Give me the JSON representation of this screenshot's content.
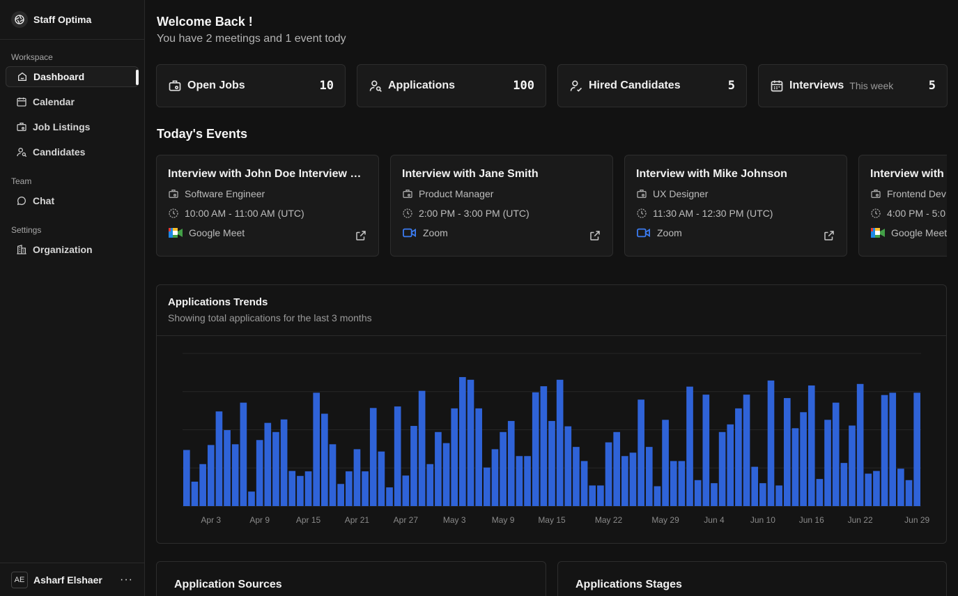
{
  "brand": {
    "name": "Staff Optima"
  },
  "sidebar": {
    "sections": [
      {
        "label": "Workspace",
        "items": [
          {
            "label": "Dashboard",
            "icon": "home-icon",
            "active": true
          },
          {
            "label": "Calendar",
            "icon": "calendar-icon"
          },
          {
            "label": "Job Listings",
            "icon": "briefcase-icon"
          },
          {
            "label": "Candidates",
            "icon": "user-search-icon"
          }
        ]
      },
      {
        "label": "Team",
        "items": [
          {
            "label": "Chat",
            "icon": "chat-icon"
          }
        ]
      },
      {
        "label": "Settings",
        "items": [
          {
            "label": "Organization",
            "icon": "building-icon"
          }
        ]
      }
    ],
    "user": {
      "initials": "AE",
      "name": "Asharf Elshaer",
      "menu": "···"
    }
  },
  "header": {
    "title": "Welcome Back !",
    "subtitle": "You have 2 meetings and 1 event tody"
  },
  "stats": [
    {
      "label": "Open Jobs",
      "value": "10",
      "icon": "briefcase-icon"
    },
    {
      "label": "Applications",
      "value": "100",
      "icon": "user-search-icon"
    },
    {
      "label": "Hired Candidates",
      "value": "5",
      "icon": "user-check-icon"
    },
    {
      "label": "Interviews",
      "sub": "This week",
      "value": "5",
      "icon": "calendar-icon"
    }
  ],
  "events": {
    "title": "Today's Events",
    "items": [
      {
        "title": "Interview with John Doe Interview …",
        "role": "Software Engineer",
        "time": "10:00 AM - 11:00 AM (UTC)",
        "platform": "Google Meet",
        "platform_icon": "google-meet-icon"
      },
      {
        "title": "Interview with Jane Smith",
        "role": "Product Manager",
        "time": "2:00 PM - 3:00 PM (UTC)",
        "platform": "Zoom",
        "platform_icon": "zoom-icon"
      },
      {
        "title": "Interview with Mike Johnson",
        "role": "UX Designer",
        "time": "11:30 AM - 12:30 PM (UTC)",
        "platform": "Zoom",
        "platform_icon": "zoom-icon"
      },
      {
        "title": "Interview with",
        "role": "Frontend Dev",
        "time": "4:00 PM - 5:0",
        "platform": "Google Meet",
        "platform_icon": "google-meet-icon"
      }
    ]
  },
  "chart_card": {
    "title": "Applications Trends",
    "subtitle": "Showing total applications for the last 3 months"
  },
  "chart_data": {
    "type": "bar",
    "title": "Applications Trends",
    "bar_color": "#2f63d8",
    "grid": true,
    "ylim": [
      0,
      400
    ],
    "x_tick_labels": [
      "Apr 3",
      "Apr 9",
      "Apr 15",
      "Apr 21",
      "Apr 27",
      "May 3",
      "May 9",
      "May 15",
      "May 22",
      "May 29",
      "Jun 4",
      "Jun 10",
      "Jun 16",
      "Jun 22",
      "Jun 29"
    ],
    "x_tick_positions": [
      3,
      9,
      15,
      21,
      27,
      33,
      39,
      45,
      52,
      59,
      65,
      71,
      77,
      83,
      90
    ],
    "values": [
      147,
      64,
      110,
      160,
      248,
      199,
      162,
      271,
      38,
      173,
      218,
      194,
      227,
      92,
      79,
      91,
      297,
      242,
      162,
      58,
      91,
      149,
      91,
      257,
      143,
      49,
      261,
      80,
      210,
      302,
      110,
      194,
      165,
      256,
      338,
      331,
      256,
      101,
      149,
      194,
      223,
      131,
      131,
      298,
      314,
      223,
      331,
      209,
      155,
      118,
      54,
      54,
      167,
      194,
      131,
      140,
      279,
      155,
      52,
      226,
      118,
      118,
      313,
      68,
      292,
      60,
      194,
      214,
      256,
      292,
      103,
      60,
      329,
      54,
      283,
      204,
      246,
      316,
      71,
      226,
      271,
      113,
      211,
      320,
      85,
      92,
      291,
      297,
      98,
      68,
      297
    ]
  },
  "bottom_cards": [
    {
      "title": "Application Sources"
    },
    {
      "title": "Applications Stages"
    }
  ]
}
